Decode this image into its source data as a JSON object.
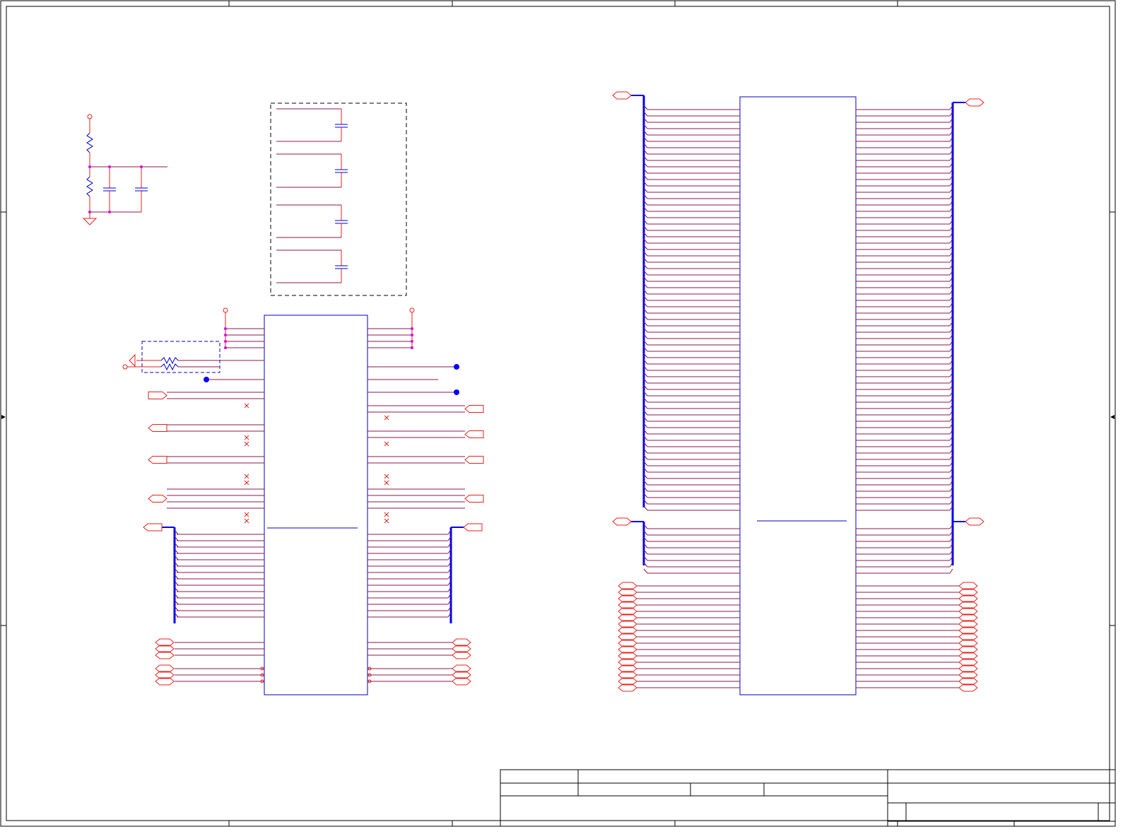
{
  "sheet": {
    "title_block": {
      "title": "",
      "size": "",
      "document_number": "",
      "revision": "",
      "date": "",
      "sheet_of": ""
    }
  },
  "colors": {
    "wire_red": "#e8201c",
    "wire_net": "#8b1a4a",
    "bus_blue": "#0000ff",
    "component_blue": "#0000c8",
    "junction_magenta": "#e000e0",
    "frame": "#000000",
    "offpage_connector": "#e8201c",
    "no_connect": "#e8201c"
  },
  "components": [
    {
      "ref_name": "voltage-divider-rc-network",
      "icon": "resistor-capacitor-icon"
    },
    {
      "ref_name": "decoupling-capacitor-group",
      "icon": "capacitor-icon"
    },
    {
      "ref_name": "left-ic-u1",
      "icon": "ic-package-icon"
    },
    {
      "ref_name": "right-ic-u2",
      "icon": "ic-package-icon"
    },
    {
      "ref_name": "reset-resistor-network",
      "icon": "resistor-icon"
    }
  ]
}
